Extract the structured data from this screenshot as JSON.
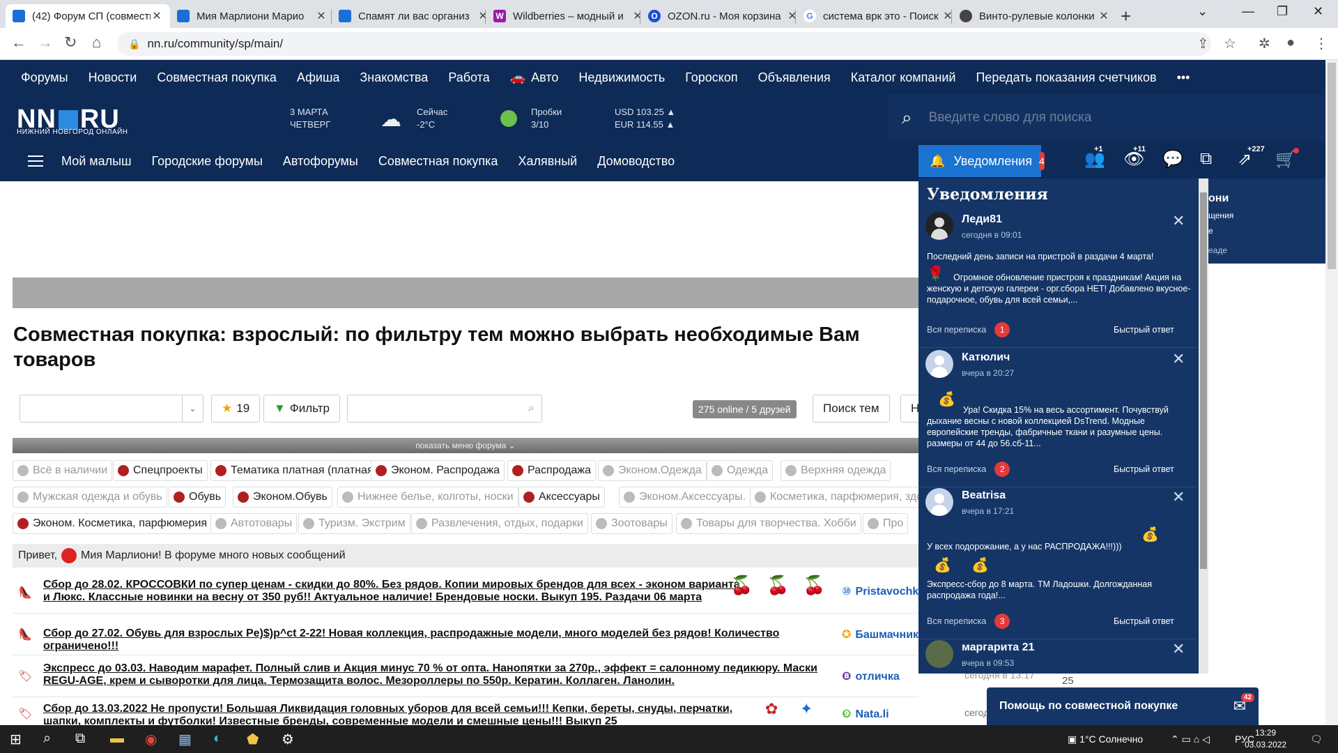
{
  "browser": {
    "tabs": [
      {
        "title": "(42) Форум СП (совместн",
        "color": "#1a6fd6",
        "glyph": ""
      },
      {
        "title": "Мия Марлиони Марио",
        "color": "#1a6fd6",
        "glyph": ""
      },
      {
        "title": "Спамят ли вас организ",
        "color": "#1a6fd6",
        "glyph": ""
      },
      {
        "title": "Wildberries – модный и",
        "color": "#9b1aa8",
        "glyph": "W"
      },
      {
        "title": "OZON.ru - Моя корзина",
        "color": "#1a4fd6",
        "glyph": "O"
      },
      {
        "title": "система врк это - Поиск",
        "color": "#ffffff",
        "glyph": "G"
      },
      {
        "title": "Винто-рулевые колонки",
        "color": "#444444",
        "glyph": ""
      }
    ],
    "url": "nn.ru/community/sp/main/"
  },
  "site": {
    "topnav": [
      "Форумы",
      "Новости",
      "Совместная покупка",
      "Афиша",
      "Знакомства",
      "Работа",
      "Авто",
      "Недвижимость",
      "Гороскоп",
      "Объявления",
      "Каталог компаний",
      "Передать показания счетчиков",
      "•••"
    ],
    "logo": {
      "text_left": "NN",
      "text_right": "RU",
      "sub": "НИЖНИЙ НОВГОРОД ОНЛАЙН"
    },
    "date": {
      "day": "3 МАРТА",
      "weekday": "ЧЕТВЕРГ"
    },
    "weather": {
      "label": "Сейчас",
      "value": "-2°C"
    },
    "traffic": {
      "label": "Пробки",
      "value": "3/10"
    },
    "rates": {
      "usd": "USD 103.25 ▲",
      "eur": "EUR 114.55 ▲"
    },
    "search_placeholder": "Введите слово для поиска",
    "subnav": [
      "Мой малыш",
      "Городские форумы",
      "Автофорумы",
      "Совместная покупка",
      "Халявный",
      "Домоводство"
    ],
    "notif_label": "Уведомления",
    "notif_count": "4",
    "icon_badges": {
      "friends": "+1",
      "views": "+11",
      "rating": "+227"
    }
  },
  "main": {
    "title": "Совместная покупка: взрослый: по фильтру тем можно выбрать необходимые Вам товаров",
    "star_count": "19",
    "filter_label": "Фильтр",
    "online": "275 online / 5 друзей",
    "search_topics": "Поиск тем",
    "menu_toggle": "показать меню форума ⌄",
    "cats_row1": [
      {
        "label": "Всё в наличии",
        "dim": true
      },
      {
        "label": "Спецпроекты",
        "dim": false
      },
      {
        "label": "Тематика платная (платная)",
        "dim": false
      },
      {
        "label": "Эконом. Распродажа",
        "dim": false
      },
      {
        "label": "Распродажа",
        "dim": false
      },
      {
        "label": "Эконом.Одежда",
        "dim": true
      },
      {
        "label": "Одежда",
        "dim": true
      },
      {
        "label": "Верхняя одежда",
        "dim": true
      }
    ],
    "cats_row2": [
      {
        "label": "Мужская одежда и обувь",
        "dim": true
      },
      {
        "label": "Обувь",
        "dim": false
      },
      {
        "label": "Эконом.Обувь",
        "dim": false
      },
      {
        "label": "Нижнее белье, колготы, носки",
        "dim": true
      },
      {
        "label": "Аксессуары",
        "dim": false
      },
      {
        "label": "Эконом.Аксессуары.",
        "dim": true
      },
      {
        "label": "Косметика, парфюмерия, здо",
        "dim": true
      }
    ],
    "cats_row3": [
      {
        "label": "Эконом. Косметика, парфюмерия",
        "dim": false
      },
      {
        "label": "Автотовары",
        "dim": true
      },
      {
        "label": "Туризм. Экстрим",
        "dim": true
      },
      {
        "label": "Развлечения, отдых, подарки",
        "dim": true
      },
      {
        "label": "Зоотовары",
        "dim": true
      },
      {
        "label": "Товары для творчества. Хобби",
        "dim": true
      },
      {
        "label": "Про",
        "dim": true
      }
    ],
    "greeting_prefix": "Привет,",
    "greeting_rest": "Мия Марлиони! В форуме много новых сообщений",
    "topics": [
      {
        "text": "Сбор до 28.02. КРОССОВКИ по супер ценам - скидки до 80%. Без рядов. Копии мировых брендов для всех - эконом варианта и Люкс. Классные новинки на весну от 350 руб!! Актуальное наличие! Брендовые носки. Выкуп 195. Раздачи 06 марта",
        "author": "Pristavochka",
        "date": ""
      },
      {
        "text": "Сбор до 27.02. Обувь для взрослых Pe)$)p^ct 2-22! Новая коллекция, распродажные модели, много моделей без рядов! Количество ограничено!!!",
        "author": "Башмачник",
        "date": ""
      },
      {
        "text": "Экспресс до 03.03. Наводим марафет. Полный слив и Акция минус 70 % от опта. Нанопятки за 270р., эффект = салонному педикюру. Маски REGU-AGE, крем и сыворотки для лица. Термозащита волос. Мезороллеры по 550р. Кератин. Коллаген. Ланолин.",
        "author": "отличка",
        "date": "сегодня в 13:17"
      },
      {
        "text": "Сбор до 13.03.2022 Не пропусти! Большая Ликвидация головных уборов для всей семьи!!! Кепки, береты, снуды, перчатки, шапки, комплекты и футболки! Известные бренды, современные модели и смешные цены!!! Выкуп 25",
        "author": "Nata.li",
        "date": "сегод"
      }
    ],
    "extra_number": "25"
  },
  "notifications": {
    "title": "Уведомления",
    "all_label": "Вся переписка",
    "reply_label": "Быстрый ответ",
    "items": [
      {
        "name": "Леди81",
        "time": "сегодня в 09:01",
        "msg1": "Последний день записи на пристрой в раздачи 4 марта!",
        "msg2": "Огромное обновление пристроя к праздникам! Акция на женскую и детскую галереи - орг.сбора НЕТ! Добавлено вкусное-подарочное, обувь для всей семьи,...",
        "count": "1"
      },
      {
        "name": "Катюлич",
        "time": "вчера в 20:27",
        "msg1": "",
        "msg2": "Ура! Скидка 15% на весь ассортимент. Почувствуй дыхание весны с новой коллекцией DsTrend. Модные европейские тренды, фабричные ткани и разумные цены. размеры от 44 до 56.сб-11...",
        "count": "2"
      },
      {
        "name": "Beatrisa",
        "time": "вчера в 17:21",
        "msg1": "У всех подорожание, а у нас РАСПРОДАЖА!!!)))",
        "msg2": "Экспресс-сбор до 8 марта. ТМ Ладошки. Долгожданная распродажа года!...",
        "count": "3"
      },
      {
        "name": "маргарита 21",
        "time": "вчера в 09:53",
        "msg1": "",
        "msg2": "",
        "count": ""
      }
    ],
    "peek": {
      "line1": "они",
      "line2": "щения",
      "line3": "е",
      "line4": "еаде"
    }
  },
  "help": {
    "label": "Помощь по совместной покупке",
    "badge": "42"
  },
  "taskbar": {
    "weather": "1°C Солнечно",
    "lang": "РУС",
    "time": "13:29",
    "date": "03.03.2022"
  }
}
